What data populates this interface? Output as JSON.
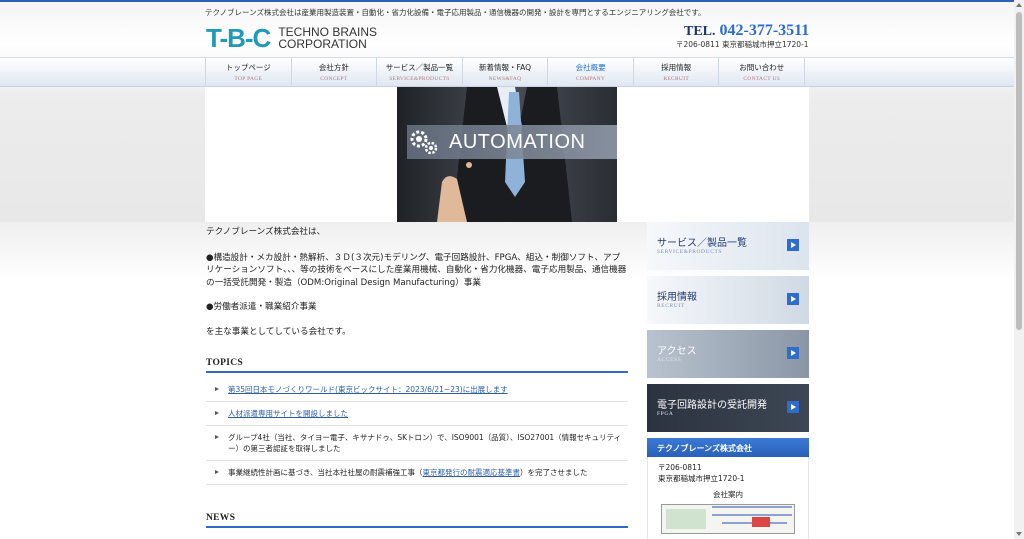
{
  "header": {
    "tagline": "テクノブレーンズ株式会社は産業用製造装置・自動化・省力化設備・電子応用製品・通信機器の開発・設計を専門とするエンジニアリング会社です。",
    "logo_mark": "T-B-C",
    "logo_line1": "TECHNO BRAINS",
    "logo_line2": "CORPORATION",
    "tel_label": "TEL.",
    "tel_number": "042-377-3511",
    "address": "〒206-0811 東京都稲城市押立1720-1"
  },
  "nav": [
    {
      "jp": "トップページ",
      "en": "TOP PAGE"
    },
    {
      "jp": "会社方針",
      "en": "CONCEPT"
    },
    {
      "jp": "サービス／製品一覧",
      "en": "SERVICE&PRODUCTS"
    },
    {
      "jp": "新着情報・FAQ",
      "en": "NEWS&FAQ"
    },
    {
      "jp": "会社概要",
      "en": "COMPANY"
    },
    {
      "jp": "採用情報",
      "en": "RECRUIT"
    },
    {
      "jp": "お問い合わせ",
      "en": "CONTACT US"
    }
  ],
  "hero": {
    "label": "AUTOMATION"
  },
  "intro": {
    "line1": "テクノブレーンズ株式会社は、",
    "para1": "●構造設計・メカ設計・熱解析、３Ｄ(３次元)モデリング、電子回路設計、FPGA、組込・制御ソフト、アプリケーションソフト、、、等の技術をベースにした産業用機械、自動化・省力化機器、電子応用製品、通信機器の一括受託開発・製造（ODM:Original Design Manufacturing）事業",
    "para2": "●労働者派遣・職業紹介事業",
    "para3": "を主な事業としてしている会社です。"
  },
  "topics": {
    "title": "TOPICS",
    "items": [
      {
        "link": "第35回日本モノづくりワールド(東京ビックサイト：2023/6/21~23)に出展します",
        "pre": "",
        "post": ""
      },
      {
        "link": "人材派遣専用サイトを開設しました",
        "pre": "",
        "post": ""
      },
      {
        "link": "",
        "pre": "グループ4社（当社、タイヨー電子、キサナドゥ、SKトロン）で、ISO9001（品質）、ISO27001（情報セキュリティー）の第三者認証を取得しました",
        "post": ""
      },
      {
        "link": "東京都発行の耐震適応基準書",
        "pre": "事業継続性計画に基づき、当社本社社屋の耐震補強工事（",
        "post": "）を完了させました"
      }
    ]
  },
  "news": {
    "title": "NEWS"
  },
  "sidebar": {
    "banners": [
      {
        "title": "サービス／製品一覧",
        "sub": "SERVICE&PRODUCTS",
        "color": "#dbe4ee"
      },
      {
        "title": "採用情報",
        "sub": "RECRUIT",
        "color": "#cfd9e4"
      },
      {
        "title": "アクセス",
        "sub": "ACCESS",
        "color": "#8a96a6"
      },
      {
        "title": "電子回路設計の受託開発",
        "sub": "FPGA",
        "color": "#3d4654"
      }
    ],
    "company": {
      "head": "テクノブレーンズ株式会社",
      "zip": "〒206-0811",
      "address": "東京都稲城市押立1720-1",
      "map_title": "会社案内"
    }
  },
  "colors": {
    "accent": "#2a60b8",
    "link": "#2a5dab"
  }
}
